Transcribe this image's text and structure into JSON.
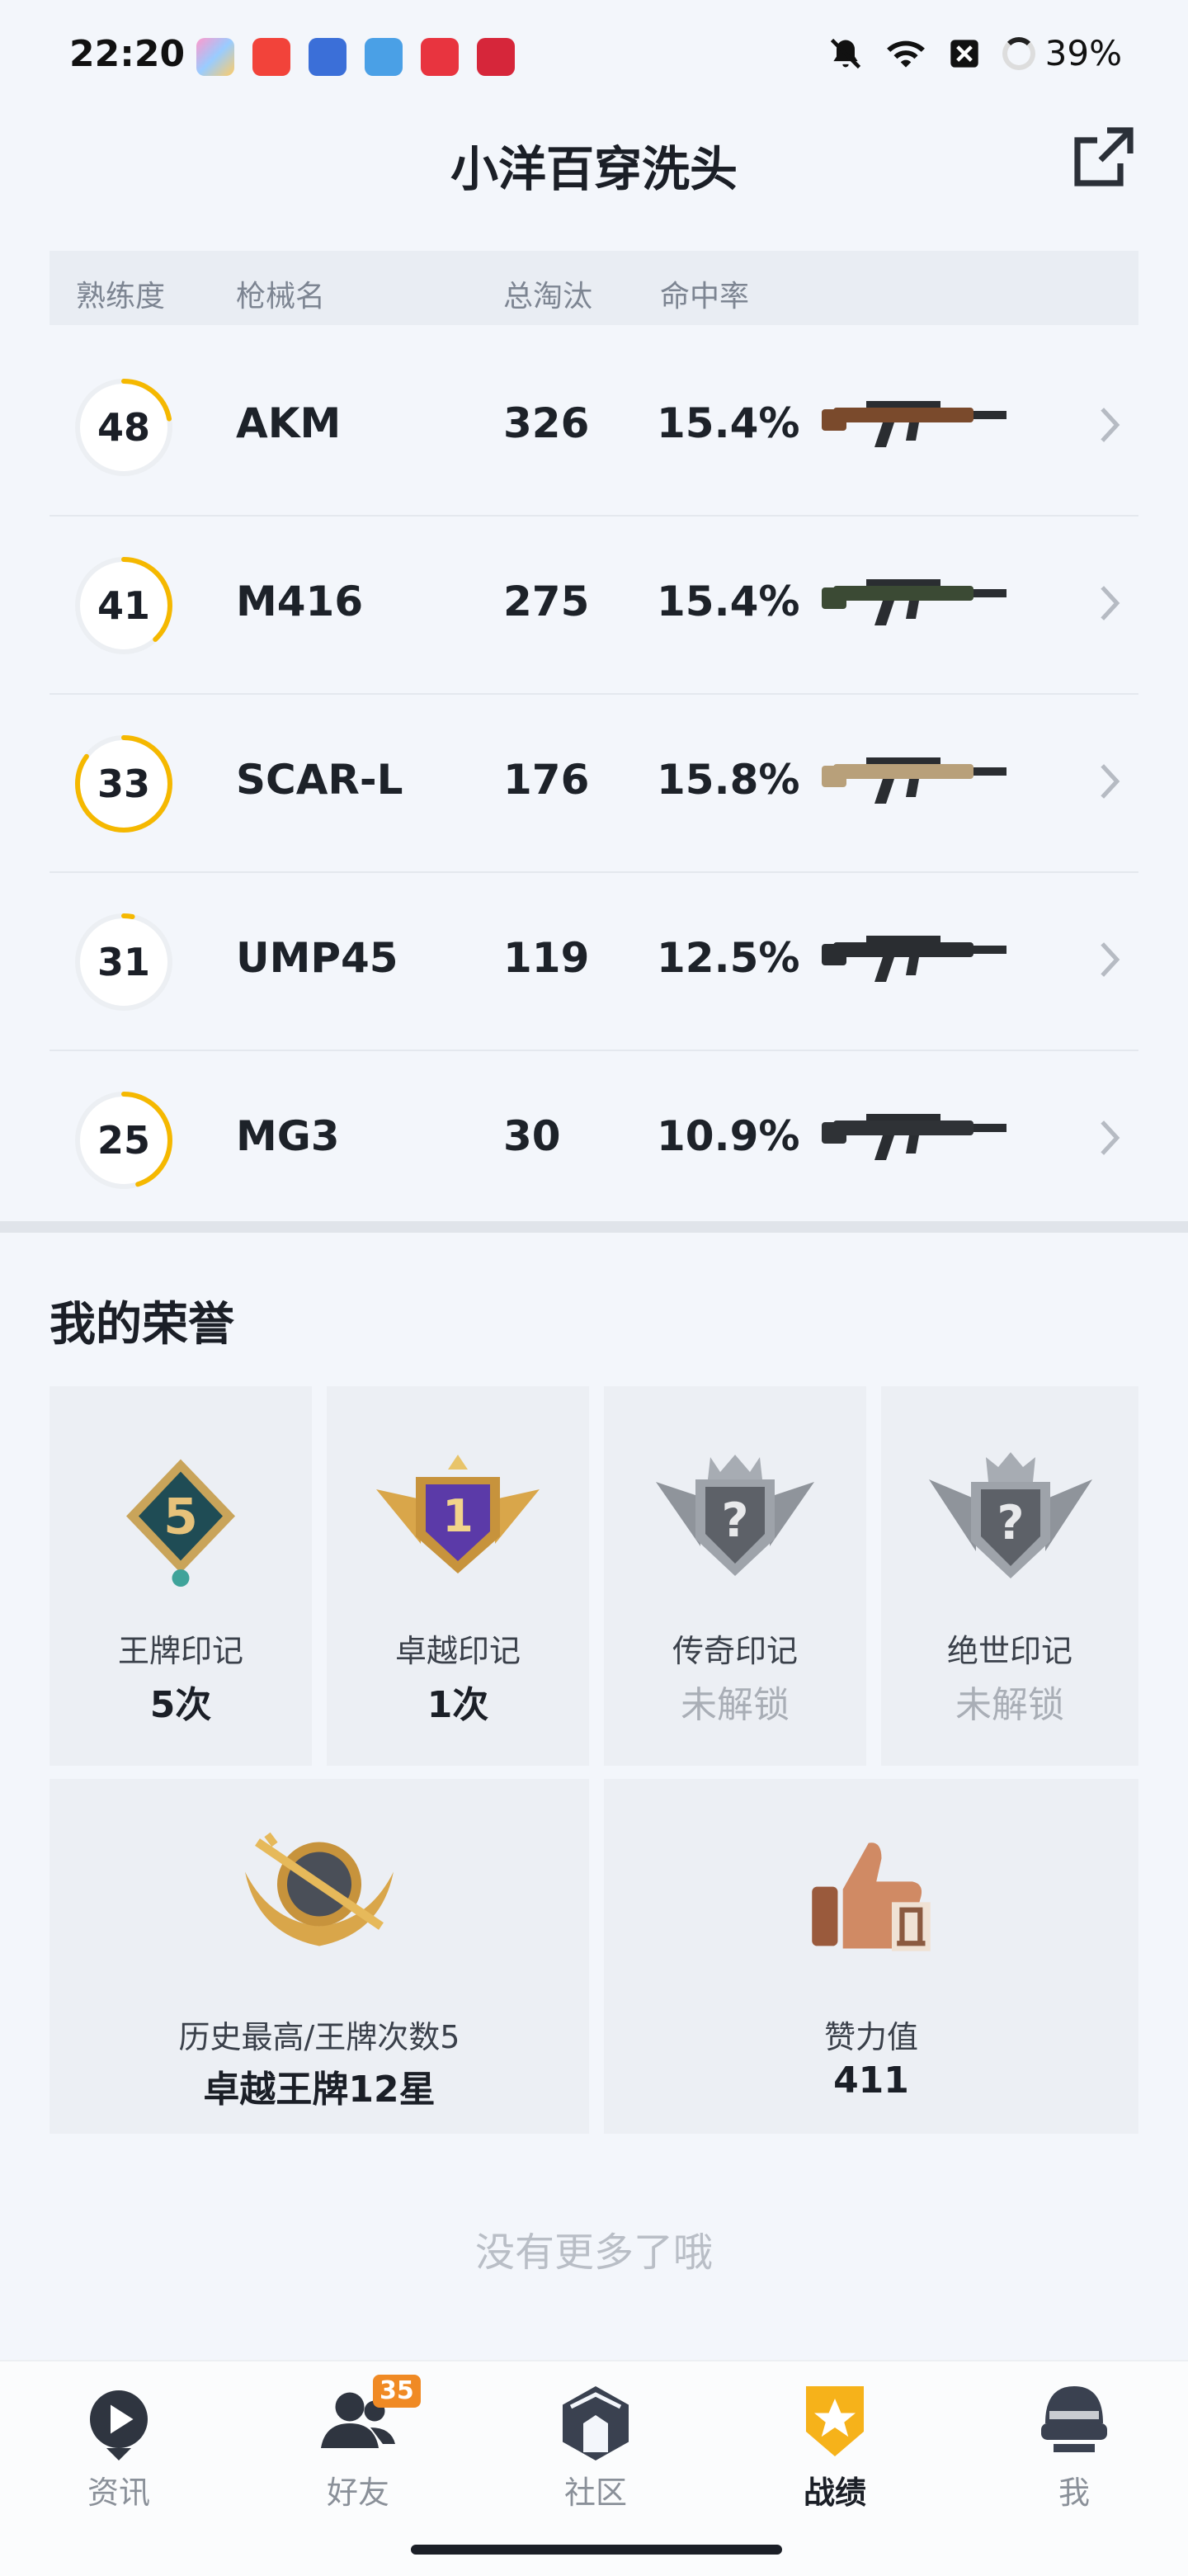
{
  "status_bar": {
    "time": "22:20",
    "battery": "39%"
  },
  "header": {
    "title": "小洋百穿洗头"
  },
  "table": {
    "headers": {
      "mastery": "熟练度",
      "weapon": "枪械名",
      "kills": "总淘汰",
      "accuracy": "命中率"
    },
    "rows": [
      {
        "mastery": "48",
        "mastery_progress": 0.22,
        "name": "AKM",
        "kills": "326",
        "accuracy": "15.4%",
        "gun_color": "#7a4a2c"
      },
      {
        "mastery": "41",
        "mastery_progress": 0.38,
        "name": "M416",
        "kills": "275",
        "accuracy": "15.4%",
        "gun_color": "#3b4a34"
      },
      {
        "mastery": "33",
        "mastery_progress": 0.85,
        "name": "SCAR-L",
        "kills": "176",
        "accuracy": "15.8%",
        "gun_color": "#b8a07a"
      },
      {
        "mastery": "31",
        "mastery_progress": 0.03,
        "name": "UMP45",
        "kills": "119",
        "accuracy": "12.5%",
        "gun_color": "#2a2d31"
      },
      {
        "mastery": "25",
        "mastery_progress": 0.45,
        "name": "MG3",
        "kills": "30",
        "accuracy": "10.9%",
        "gun_color": "#2f3236"
      }
    ]
  },
  "honors": {
    "title": "我的荣誉",
    "marks": [
      {
        "label": "王牌印记",
        "value": "5次",
        "locked": false,
        "icon": "ace-mark-icon"
      },
      {
        "label": "卓越印记",
        "value": "1次",
        "locked": false,
        "icon": "excellence-mark-icon"
      },
      {
        "label": "传奇印记",
        "value": "未解锁",
        "locked": true,
        "icon": "legend-mark-icon"
      },
      {
        "label": "绝世印记",
        "value": "未解锁",
        "locked": true,
        "icon": "peerless-mark-icon"
      }
    ],
    "highest": {
      "label": "历史最高/王牌次数5",
      "value": "卓越王牌12星",
      "icon": "rank-emblem-icon"
    },
    "likes": {
      "label": "赞力值",
      "value": "411",
      "icon": "thumbs-up-icon"
    },
    "end_text": "没有更多了哦"
  },
  "nav": [
    {
      "label": "资讯",
      "icon": "news-icon",
      "active": false
    },
    {
      "label": "好友",
      "icon": "friends-icon",
      "active": false,
      "badge": "35"
    },
    {
      "label": "社区",
      "icon": "community-icon",
      "active": false
    },
    {
      "label": "战绩",
      "icon": "record-icon",
      "active": true
    },
    {
      "label": "我",
      "icon": "profile-icon",
      "active": false
    }
  ]
}
